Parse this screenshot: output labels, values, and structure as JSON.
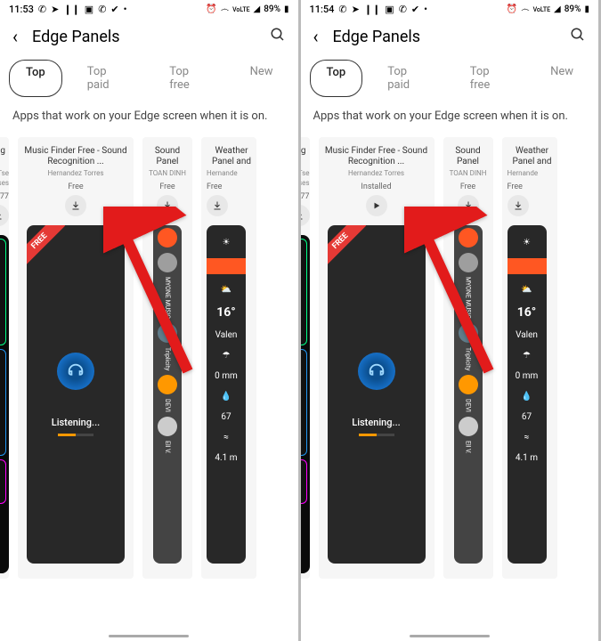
{
  "left": {
    "status": {
      "time": "11:53",
      "battery": "89%",
      "net": "VoLTE",
      "sig": "LTE1"
    },
    "header": {
      "title": "Edge Panels"
    },
    "tabs": {
      "top": "Top",
      "paid": "Top paid",
      "free": "Top free",
      "new": "New"
    },
    "desc": "Apps that work on your Edge screen when it is on.",
    "cards": {
      "c0": {
        "title": "ghting",
        "pub": "asTse",
        "sub": "rchases",
        "price": "77"
      },
      "c1": {
        "title": "Music Finder Free - Sound Recognition ...",
        "pub": "Hernandez Torres",
        "price": "Free",
        "state": "download"
      },
      "c2": {
        "title": "Sound Panel",
        "pub": "TOAN DINH",
        "price": "Free"
      },
      "c3": {
        "title": "Weather Panel and",
        "pub": "Hernande",
        "price": "Free"
      }
    },
    "preview": {
      "listening": "Listening...",
      "temp": "16°",
      "city": "Valen",
      "rain": "0 mm",
      "hum": "67",
      "wind": "4.1 m"
    },
    "sp": {
      "m": "MYONE MUSIC",
      "t": "Triplicity",
      "d": "DEVI",
      "e": "Ell V."
    }
  },
  "right": {
    "status": {
      "time": "11:54",
      "battery": "89%",
      "net": "VoLTE",
      "sig": "LTE1"
    },
    "header": {
      "title": "Edge Panels"
    },
    "tabs": {
      "top": "Top",
      "paid": "Top paid",
      "free": "Top free",
      "new": "New"
    },
    "desc": "Apps that work on your Edge screen when it is on.",
    "cards": {
      "c0": {
        "title": "ghting",
        "pub": "asTse",
        "sub": "rchases",
        "price": "77"
      },
      "c1": {
        "title": "Music Finder Free - Sound Recognition ...",
        "pub": "Hernandez Torres",
        "price": "Installed",
        "state": "play"
      },
      "c2": {
        "title": "Sound Panel",
        "pub": "TOAN DINH",
        "price": "Free"
      },
      "c3": {
        "title": "Weather Panel and",
        "pub": "Hernande",
        "price": "Free"
      }
    },
    "preview": {
      "listening": "Listening...",
      "temp": "16°",
      "city": "Valen",
      "rain": "0 mm",
      "hum": "67",
      "wind": "4.1 m"
    },
    "sp": {
      "m": "MYONE MUSIC",
      "t": "Triplicity",
      "d": "DEVI",
      "e": "Ell V."
    }
  }
}
